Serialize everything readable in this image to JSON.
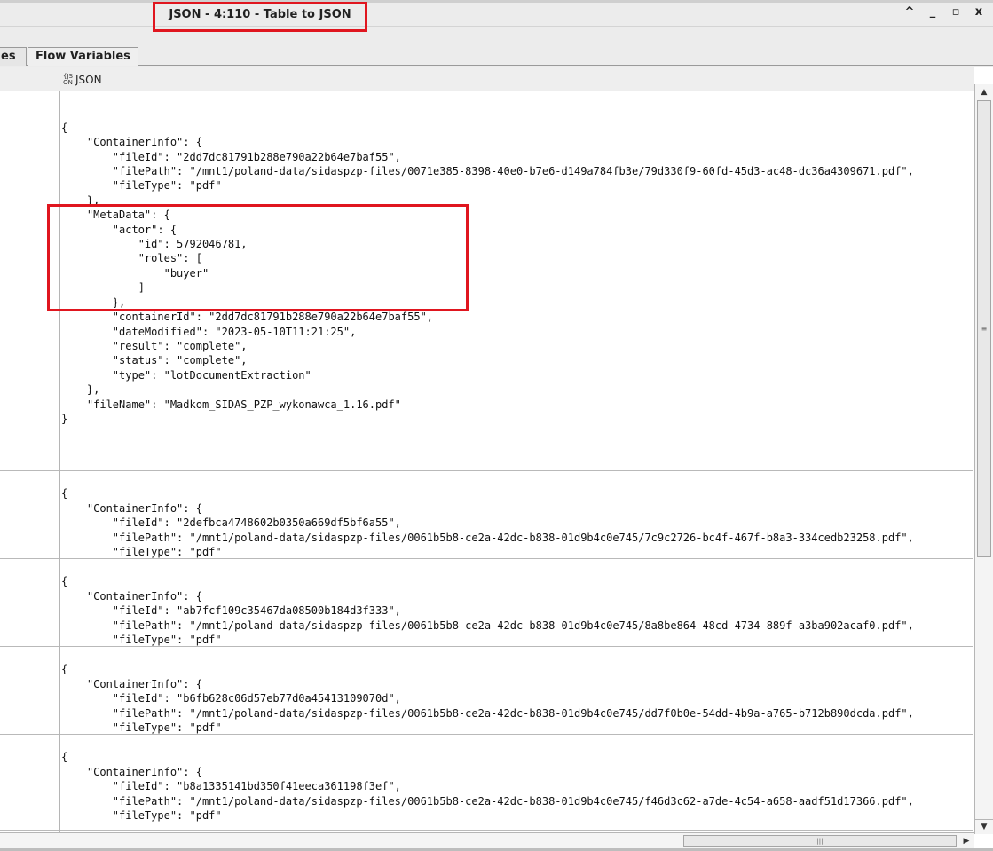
{
  "window": {
    "title": "JSON - 4:110 - Table to JSON",
    "controls": {
      "collapse": "^",
      "minimize": "_",
      "maximize": "▫",
      "close": "x"
    }
  },
  "tabs": [
    {
      "label": "es"
    },
    {
      "label": "Flow Variables"
    }
  ],
  "table": {
    "column_header": "JSON",
    "icon_text_top": "{JS",
    "icon_text_bottom": "ON",
    "rows": [
      "\n\n{\n    \"ContainerInfo\": {\n        \"fileId\": \"2dd7dc81791b288e790a22b64e7baf55\",\n        \"filePath\": \"/mnt1/poland-data/sidaspzp-files/0071e385-8398-40e0-b7e6-d149a784fb3e/79d330f9-60fd-45d3-ac48-dc36a4309671.pdf\",\n        \"fileType\": \"pdf\"\n    },\n    \"MetaData\": {\n        \"actor\": {\n            \"id\": 5792046781,\n            \"roles\": [\n                \"buyer\"\n            ]\n        },\n        \"containerId\": \"2dd7dc81791b288e790a22b64e7baf55\",\n        \"dateModified\": \"2023-05-10T11:21:25\",\n        \"result\": \"complete\",\n        \"status\": \"complete\",\n        \"type\": \"lotDocumentExtraction\"\n    },\n    \"fileName\": \"Madkom_SIDAS_PZP_wykonawca_1.16.pdf\"\n}",
      "\n{\n    \"ContainerInfo\": {\n        \"fileId\": \"2defbca4748602b0350a669df5bf6a55\",\n        \"filePath\": \"/mnt1/poland-data/sidaspzp-files/0061b5b8-ce2a-42dc-b838-01d9b4c0e745/7c9c2726-bc4f-467f-b8a3-334cedb23258.pdf\",\n        \"fileType\": \"pdf\"",
      "\n{\n    \"ContainerInfo\": {\n        \"fileId\": \"ab7fcf109c35467da08500b184d3f333\",\n        \"filePath\": \"/mnt1/poland-data/sidaspzp-files/0061b5b8-ce2a-42dc-b838-01d9b4c0e745/8a8be864-48cd-4734-889f-a3ba902acaf0.pdf\",\n        \"fileType\": \"pdf\"",
      "\n{\n    \"ContainerInfo\": {\n        \"fileId\": \"b6fb628c06d57eb77d0a45413109070d\",\n        \"filePath\": \"/mnt1/poland-data/sidaspzp-files/0061b5b8-ce2a-42dc-b838-01d9b4c0e745/dd7f0b0e-54dd-4b9a-a765-b712b890dcda.pdf\",\n        \"fileType\": \"pdf\"",
      "\n{\n    \"ContainerInfo\": {\n        \"fileId\": \"b8a1335141bd350f41eeca361198f3ef\",\n        \"filePath\": \"/mnt1/poland-data/sidaspzp-files/0061b5b8-ce2a-42dc-b838-01d9b4c0e745/f46d3c62-a7de-4c54-a658-aadf51d17366.pdf\",\n        \"fileType\": \"pdf\""
    ]
  },
  "scrollbars": {
    "up_arrow": "▲",
    "down_arrow": "▼",
    "right_arrow": "▶",
    "grip": "≡",
    "hgrip": "|||"
  },
  "colors": {
    "highlight": "#e0161f"
  }
}
